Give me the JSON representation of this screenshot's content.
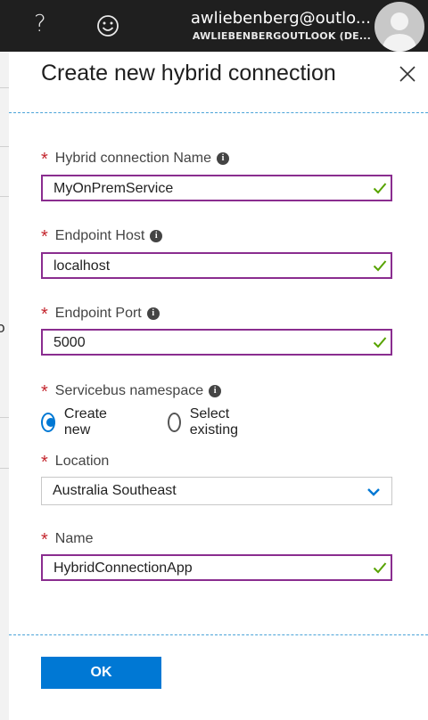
{
  "topbar": {
    "help_glyph": "?",
    "user_email": "awliebenberg@outlo...",
    "user_tenant": "AWLIEBENBERGOUTLOOK (DE..."
  },
  "left_fragment": "o",
  "panel": {
    "title": "Create new hybrid connection",
    "required_marker": "*",
    "fields": {
      "name": {
        "label": "Hybrid connection Name",
        "value": "MyOnPremService"
      },
      "host": {
        "label": "Endpoint Host",
        "value": "localhost"
      },
      "port": {
        "label": "Endpoint Port",
        "value": "5000"
      },
      "servicebus": {
        "label": "Servicebus namespace",
        "options": [
          "Create new",
          "Select existing"
        ],
        "selected": "Create new"
      },
      "location": {
        "label": "Location",
        "value": "Australia Southeast"
      },
      "sb_name": {
        "label": "Name",
        "value": "HybridConnectionApp"
      }
    },
    "info_glyph": "i",
    "ok_label": "OK"
  },
  "colors": {
    "topbar_bg": "#1f1f1f",
    "input_border_valid": "#8a2d8f",
    "valid_check": "#57a300",
    "required": "#c4262e",
    "primary": "#0078d4",
    "divider": "#4aa3d8"
  },
  "icons": [
    "help-icon",
    "feedback-smiley-icon",
    "avatar",
    "close-icon",
    "info-icon",
    "checkmark-icon",
    "chevron-down-icon"
  ]
}
